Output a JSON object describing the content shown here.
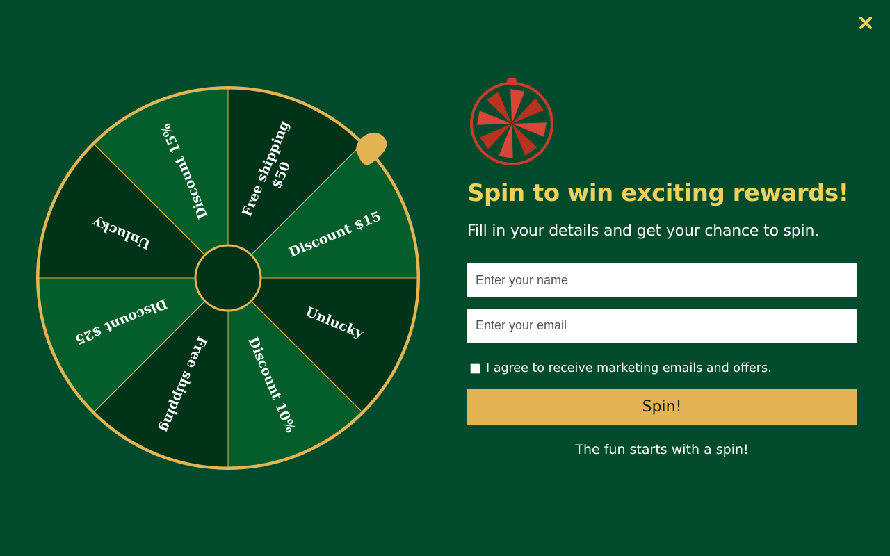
{
  "colors": {
    "background": "#004b2b",
    "segment_dark": "#003419",
    "segment_light": "#035e2b",
    "accent_gold": "#e3b454",
    "headline_yellow": "#f1cf5d",
    "logo_red": "#cc3b2c"
  },
  "close": {
    "icon": "close-icon"
  },
  "wheel": {
    "pointer_icon": "pointer-icon",
    "segments": [
      {
        "label": "Free shipping",
        "label2": "$50",
        "color": "dark"
      },
      {
        "label": "Discount $15",
        "label2": "",
        "color": "light"
      },
      {
        "label": "Unlucky",
        "label2": "",
        "color": "dark"
      },
      {
        "label": "Discount 10%",
        "label2": "",
        "color": "light"
      },
      {
        "label": "Free shipping",
        "label2": "",
        "color": "dark"
      },
      {
        "label": "Discount $25",
        "label2": "",
        "color": "light"
      },
      {
        "label": "Unlucky",
        "label2": "",
        "color": "dark"
      },
      {
        "label": "Discount 15%",
        "label2": "",
        "color": "light"
      }
    ]
  },
  "panel": {
    "logo_icon": "prize-wheel-icon",
    "headline": "Spin to win exciting rewards!",
    "subtitle": "Fill in your details and get your chance to spin.",
    "name_placeholder": "Enter your name",
    "name_value": "",
    "email_placeholder": "Enter your email",
    "email_value": "",
    "consent_label": "I agree to receive marketing emails and offers.",
    "consent_checked": false,
    "spin_label": "Spin!",
    "footnote": "The fun starts with a spin!"
  }
}
